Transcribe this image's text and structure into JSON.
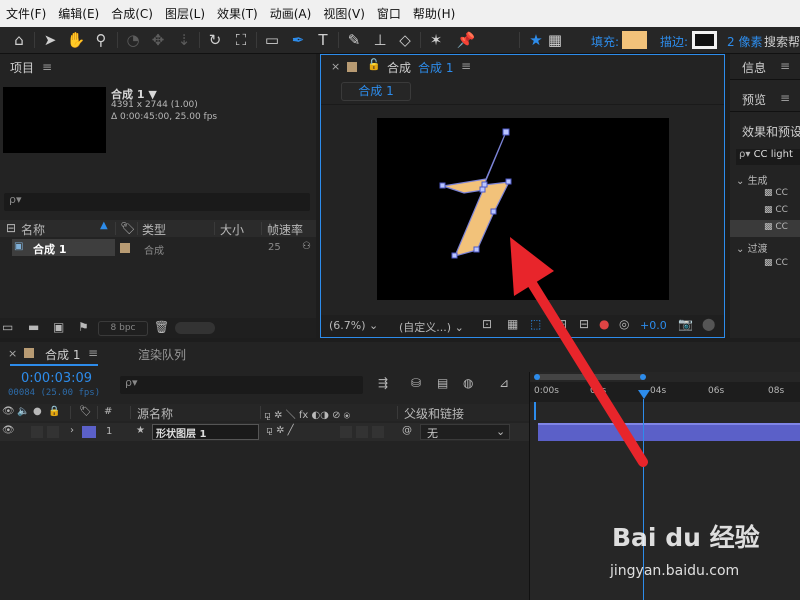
{
  "menu": [
    "文件(F)",
    "编辑(E)",
    "合成(C)",
    "图层(L)",
    "效果(T)",
    "动画(A)",
    "视图(V)",
    "窗口",
    "帮助(H)"
  ],
  "toolbar": {
    "fill_label": "填充:",
    "stroke_label": "描边:",
    "stroke_width": "2 像素",
    "search_help": "搜索帮",
    "fill_color": "#f2c27a"
  },
  "project": {
    "title": "项目",
    "comp_name": "合成 1",
    "dims": "4391 x 2744 (1.00)",
    "duration": "Δ 0:00:45:00, 25.00 fps",
    "search_placeholder": "ρ▾",
    "columns": [
      "名称",
      "类型",
      "大小",
      "帧速率"
    ],
    "rows": [
      {
        "name": "合成 1",
        "type": "合成",
        "size": "",
        "fps": "25"
      }
    ],
    "bpc": "8 bpc"
  },
  "composition": {
    "close": "×",
    "title_prefix": "合成",
    "title_name": "合成 1",
    "tab": "合成 1",
    "zoom": "(6.7%)",
    "resolution": "(自定义...)",
    "exposure": "+0.0",
    "shape_fill": "#f2c27a"
  },
  "right_panels": {
    "info": "信息",
    "preview": "预览",
    "effects": "效果和预设",
    "search_value": "CC light",
    "groups": [
      {
        "name": "生成",
        "items": [
          "CC",
          "CC",
          "CC"
        ]
      },
      {
        "name": "过渡",
        "items": [
          "CC"
        ]
      }
    ]
  },
  "timeline": {
    "comp_tab": "合成 1",
    "render_tab": "渲染队列",
    "timecode": "0:00:03:09",
    "frame_info": "00084 (25.00 fps)",
    "search_placeholder": "ρ▾",
    "cols": {
      "num": "#",
      "source": "源名称",
      "parent": "父级和链接"
    },
    "layer": {
      "index": "1",
      "name": "形状图层 1",
      "parent": "无"
    },
    "ruler": [
      "0:00s",
      "02s",
      "04s",
      "06s",
      "08s"
    ]
  },
  "watermark": {
    "brand": "Bai du 经验",
    "url": "jingyan.baidu.com"
  },
  "colors": {
    "accent": "#2d8ceb",
    "arrow": "#e8252b",
    "layer_bar": "#5b60c8",
    "label_color": "#b89b73"
  }
}
